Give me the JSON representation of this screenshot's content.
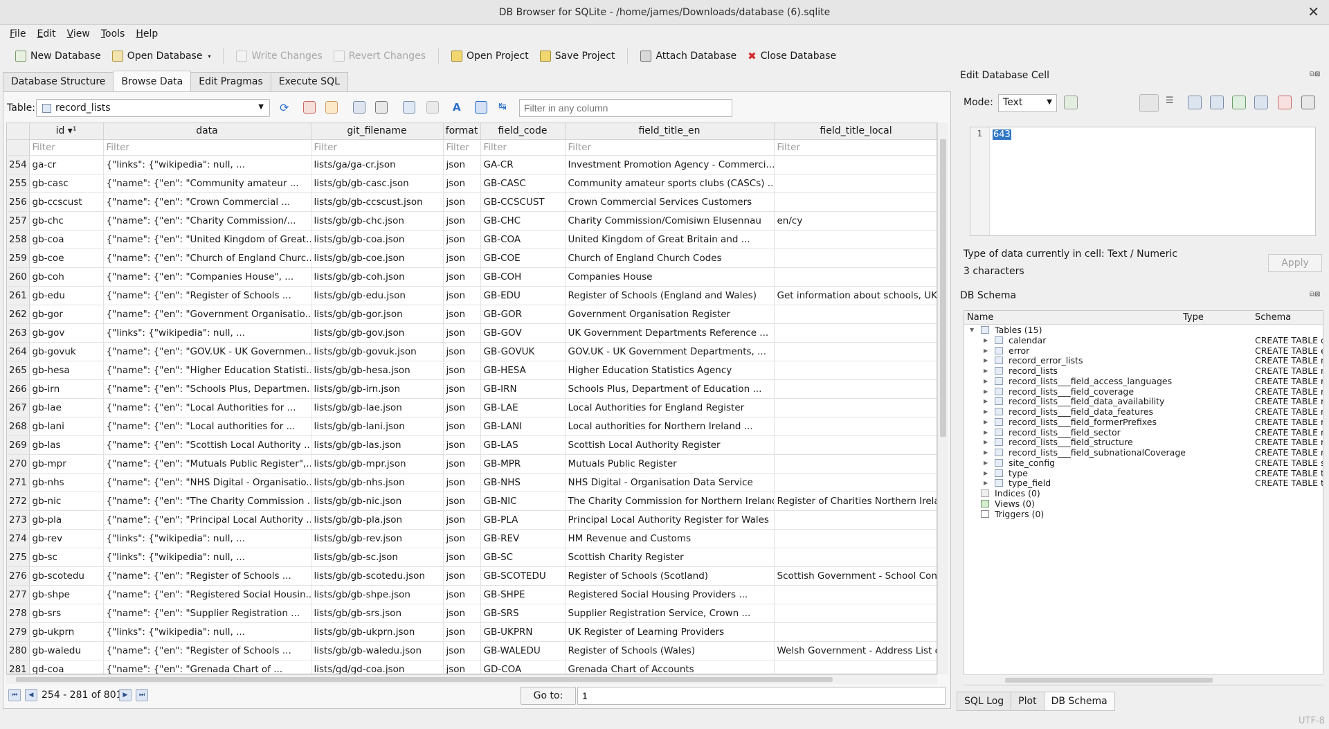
{
  "window": {
    "title": "DB Browser for SQLite - /home/james/Downloads/database (6).sqlite"
  },
  "menu": [
    "File",
    "Edit",
    "View",
    "Tools",
    "Help"
  ],
  "toolbar": {
    "new_db": "New Database",
    "open_db": "Open Database",
    "write": "Write Changes",
    "revert": "Revert Changes",
    "open_project": "Open Project",
    "save_project": "Save Project",
    "attach": "Attach Database",
    "close": "Close Database"
  },
  "tabs": [
    "Database Structure",
    "Browse Data",
    "Edit Pragmas",
    "Execute SQL"
  ],
  "browse": {
    "table_label": "Table:",
    "table_name": "record_lists",
    "filter_any_placeholder": "Filter in any column",
    "columns": [
      "id ▾¹",
      "data",
      "git_filename",
      "format",
      "field_code",
      "field_title_en",
      "field_title_local"
    ],
    "filter_placeholder": "Filter",
    "rows": [
      [
        "254",
        "ga-cr",
        "{\"links\": {\"wikipedia\": null, ...",
        "lists/ga/ga-cr.json",
        "json",
        "GA-CR",
        "Investment Promotion Agency - Commerci...",
        ""
      ],
      [
        "255",
        "gb-casc",
        "{\"name\": {\"en\": \"Community amateur ...",
        "lists/gb/gb-casc.json",
        "json",
        "GB-CASC",
        "Community amateur sports clubs (CASCs) ...",
        ""
      ],
      [
        "256",
        "gb-ccscust",
        "{\"name\": {\"en\": \"Crown Commercial ...",
        "lists/gb/gb-ccscust.json",
        "json",
        "GB-CCSCUST",
        "Crown Commercial Services Customers",
        ""
      ],
      [
        "257",
        "gb-chc",
        "{\"name\": {\"en\": \"Charity Commission/...",
        "lists/gb/gb-chc.json",
        "json",
        "GB-CHC",
        "Charity Commission/Comisiwn Elusennau",
        "en/cy"
      ],
      [
        "258",
        "gb-coa",
        "{\"name\": {\"en\": \"United Kingdom of Great...",
        "lists/gb/gb-coa.json",
        "json",
        "GB-COA",
        "United Kingdom of Great Britain and ...",
        ""
      ],
      [
        "259",
        "gb-coe",
        "{\"name\": {\"en\": \"Church of England Churc...",
        "lists/gb/gb-coe.json",
        "json",
        "GB-COE",
        "Church of England Church Codes",
        ""
      ],
      [
        "260",
        "gb-coh",
        "{\"name\": {\"en\": \"Companies House\", ...",
        "lists/gb/gb-coh.json",
        "json",
        "GB-COH",
        "Companies House",
        ""
      ],
      [
        "261",
        "gb-edu",
        "{\"name\": {\"en\": \"Register of Schools ...",
        "lists/gb/gb-edu.json",
        "json",
        "GB-EDU",
        "Register of Schools (England and Wales)",
        "Get information about schools, UK Re"
      ],
      [
        "262",
        "gb-gor",
        "{\"name\": {\"en\": \"Government Organisatio...",
        "lists/gb/gb-gor.json",
        "json",
        "GB-GOR",
        "Government Organisation Register",
        ""
      ],
      [
        "263",
        "gb-gov",
        "{\"links\": {\"wikipedia\": null, ...",
        "lists/gb/gb-gov.json",
        "json",
        "GB-GOV",
        "UK Government Departments Reference ...",
        ""
      ],
      [
        "264",
        "gb-govuk",
        "{\"name\": {\"en\": \"GOV.UK - UK Governmen...",
        "lists/gb/gb-govuk.json",
        "json",
        "GB-GOVUK",
        "GOV.UK - UK Government Departments, ...",
        ""
      ],
      [
        "265",
        "gb-hesa",
        "{\"name\": {\"en\": \"Higher Education Statisti...",
        "lists/gb/gb-hesa.json",
        "json",
        "GB-HESA",
        "Higher Education Statistics Agency",
        ""
      ],
      [
        "266",
        "gb-irn",
        "{\"name\": {\"en\": \"Schools Plus, Departmen...",
        "lists/gb/gb-irn.json",
        "json",
        "GB-IRN",
        "Schools Plus, Department of Education ...",
        ""
      ],
      [
        "267",
        "gb-lae",
        "{\"name\": {\"en\": \"Local Authorities for ...",
        "lists/gb/gb-lae.json",
        "json",
        "GB-LAE",
        "Local Authorities for England Register",
        ""
      ],
      [
        "268",
        "gb-lani",
        "{\"name\": {\"en\": \"Local authorities for ...",
        "lists/gb/gb-lani.json",
        "json",
        "GB-LANI",
        "Local authorities for Northern Ireland ...",
        ""
      ],
      [
        "269",
        "gb-las",
        "{\"name\": {\"en\": \"Scottish Local Authority ...",
        "lists/gb/gb-las.json",
        "json",
        "GB-LAS",
        "Scottish Local Authority Register",
        ""
      ],
      [
        "270",
        "gb-mpr",
        "{\"name\": {\"en\": \"Mutuals Public Register\",...",
        "lists/gb/gb-mpr.json",
        "json",
        "GB-MPR",
        "Mutuals Public Register",
        ""
      ],
      [
        "271",
        "gb-nhs",
        "{\"name\": {\"en\": \"NHS Digital - Organisatio...",
        "lists/gb/gb-nhs.json",
        "json",
        "GB-NHS",
        "NHS Digital - Organisation Data Service",
        ""
      ],
      [
        "272",
        "gb-nic",
        "{\"name\": {\"en\": \"The Charity Commission ...",
        "lists/gb/gb-nic.json",
        "json",
        "GB-NIC",
        "The Charity Commission for Northern Ireland",
        "Register of Charities Northern Irelanc"
      ],
      [
        "273",
        "gb-pla",
        "{\"name\": {\"en\": \"Principal Local Authority ...",
        "lists/gb/gb-pla.json",
        "json",
        "GB-PLA",
        "Principal Local Authority Register for Wales",
        ""
      ],
      [
        "274",
        "gb-rev",
        "{\"links\": {\"wikipedia\": null, ...",
        "lists/gb/gb-rev.json",
        "json",
        "GB-REV",
        "HM Revenue and Customs",
        ""
      ],
      [
        "275",
        "gb-sc",
        "{\"links\": {\"wikipedia\": null, ...",
        "lists/gb/gb-sc.json",
        "json",
        "GB-SC",
        "Scottish Charity Register",
        ""
      ],
      [
        "276",
        "gb-scotedu",
        "{\"name\": {\"en\": \"Register of Schools ...",
        "lists/gb/gb-scotedu.json",
        "json",
        "GB-SCOTEDU",
        "Register of Schools (Scotland)",
        "Scottish Government - School Conta"
      ],
      [
        "277",
        "gb-shpe",
        "{\"name\": {\"en\": \"Registered Social Housin...",
        "lists/gb/gb-shpe.json",
        "json",
        "GB-SHPE",
        "Registered Social Housing Providers ...",
        ""
      ],
      [
        "278",
        "gb-srs",
        "{\"name\": {\"en\": \"Supplier Registration ...",
        "lists/gb/gb-srs.json",
        "json",
        "GB-SRS",
        "Supplier Registration Service, Crown ...",
        ""
      ],
      [
        "279",
        "gb-ukprn",
        "{\"links\": {\"wikipedia\": null, ...",
        "lists/gb/gb-ukprn.json",
        "json",
        "GB-UKPRN",
        "UK Register of Learning Providers",
        ""
      ],
      [
        "280",
        "gb-waledu",
        "{\"name\": {\"en\": \"Register of Schools ...",
        "lists/gb/gb-waledu.json",
        "json",
        "GB-WALEDU",
        "Register of Schools (Wales)",
        "Welsh Government - Address List of"
      ],
      [
        "281",
        "gd-coa",
        "{\"name\": {\"en\": \"Grenada Chart of ...",
        "lists/gd/gd-coa.json",
        "json",
        "GD-COA",
        "Grenada Chart of Accounts",
        ""
      ]
    ],
    "records": "254 - 281 of 801",
    "goto_label": "Go to:",
    "goto_value": "1"
  },
  "edit_cell": {
    "title": "Edit Database Cell",
    "mode_label": "Mode:",
    "mode_value": "Text",
    "line_no": "1",
    "value": "643",
    "type_info": "Type of data currently in cell: Text / Numeric",
    "char_info": "3 characters",
    "apply": "Apply"
  },
  "schema": {
    "title": "DB Schema",
    "headers": [
      "Name",
      "Type",
      "Schema"
    ],
    "tables_label": "Tables (15)",
    "tables": [
      [
        "calendar",
        "CREATE TABLE c"
      ],
      [
        "error",
        "CREATE TABLE e"
      ],
      [
        "record_error_lists",
        "CREATE TABLE r"
      ],
      [
        "record_lists",
        "CREATE TABLE r"
      ],
      [
        "record_lists___field_access_languages",
        "CREATE TABLE r"
      ],
      [
        "record_lists___field_coverage",
        "CREATE TABLE r"
      ],
      [
        "record_lists___field_data_availability",
        "CREATE TABLE r"
      ],
      [
        "record_lists___field_data_features",
        "CREATE TABLE r"
      ],
      [
        "record_lists___field_formerPrefixes",
        "CREATE TABLE r"
      ],
      [
        "record_lists___field_sector",
        "CREATE TABLE r"
      ],
      [
        "record_lists___field_structure",
        "CREATE TABLE r"
      ],
      [
        "record_lists___field_subnationalCoverage",
        "CREATE TABLE r"
      ],
      [
        "site_config",
        "CREATE TABLE s"
      ],
      [
        "type",
        "CREATE TABLE t"
      ],
      [
        "type_field",
        "CREATE TABLE t"
      ]
    ],
    "indices": "Indices (0)",
    "views": "Views (0)",
    "triggers": "Triggers (0)"
  },
  "bottom_tabs": [
    "SQL Log",
    "Plot",
    "DB Schema"
  ],
  "status": {
    "encoding": "UTF-8"
  },
  "colors": {
    "accent": "#3277c6",
    "close_red": "#d42a2a"
  }
}
